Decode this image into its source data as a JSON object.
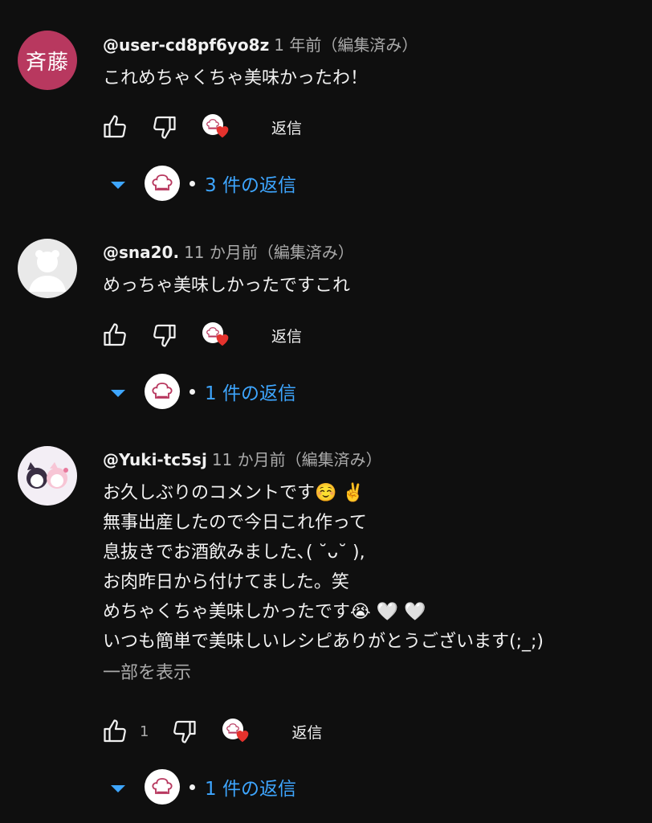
{
  "comments": [
    {
      "author": "@user-cd8pf6yo8z",
      "time": "1 年前（編集済み）",
      "avatar_text": "斉藤",
      "avatar_color": "#b8385f",
      "lines": [
        "これめちゃくちゃ美味かったわ！"
      ],
      "like_count": "",
      "reply_label": "返信",
      "replies_label": "3 件の返信"
    },
    {
      "author": "@sna20.",
      "time": "11 か月前（編集済み）",
      "avatar_text": "",
      "avatar_color": "#e0e0e0",
      "lines": [
        "めっちゃ美味しかったですこれ"
      ],
      "like_count": "",
      "reply_label": "返信",
      "replies_label": "1 件の返信"
    },
    {
      "author": "@Yuki-tc5sj",
      "time": "11 か月前（編集済み）",
      "avatar_text": "",
      "avatar_color": "#f3eef5",
      "lines": [
        "お久しぶりのコメントです☺️ ✌️",
        "無事出産したので今日これ作って",
        "息抜きでお酒飲みました､( ˘ᴗ˘ ),",
        "お肉昨日から付けてました。笑",
        "めちゃくちゃ美味しかったです😭 🤍 🤍",
        "いつも簡単で美味しいレシピありがとうございます(;_;)"
      ],
      "show_more": "一部を表示",
      "like_count": "1",
      "reply_label": "返信",
      "replies_label": "1 件の返信"
    }
  ],
  "icons": {
    "like": "thumbs-up-icon",
    "dislike": "thumbs-down-icon",
    "creator_heart": "creator-heart-icon",
    "expand": "chevron-down-icon"
  },
  "colors": {
    "background": "#0f0f0f",
    "link_blue": "#3ea6ff",
    "heart_red": "#e5322d"
  }
}
